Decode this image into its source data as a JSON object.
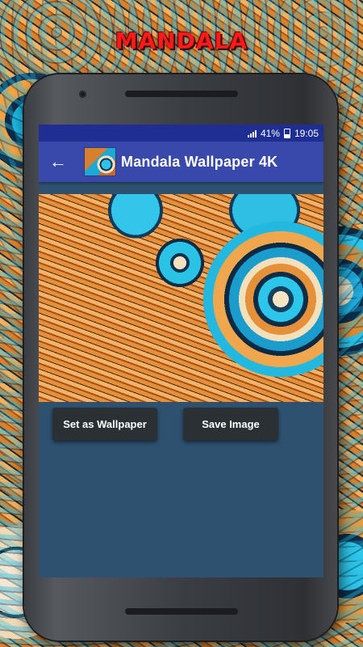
{
  "banner": {
    "text": "MANDALA"
  },
  "status_bar": {
    "battery": "41%",
    "time": "19:05"
  },
  "toolbar": {
    "title": "Mandala Wallpaper 4K",
    "back_icon": "arrow-left-icon"
  },
  "actions": {
    "set_wallpaper_label": "Set as Wallpaper",
    "save_image_label": "Save Image"
  },
  "colors": {
    "status_bar": "#1f2e92",
    "toolbar": "#3949ab",
    "screen_bg": "#2e5170",
    "button_bg": "#2b3035",
    "banner_text": "#ff1a1a"
  }
}
